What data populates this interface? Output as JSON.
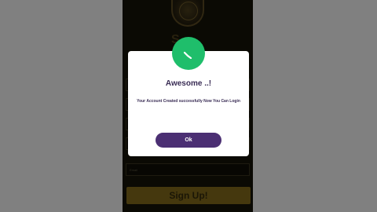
{
  "dialog": {
    "title": "Awesome ..!",
    "message": "Your Account Created successfully Now You Can Login",
    "ok_label": "Ok",
    "icon": "success-check-icon"
  },
  "background": {
    "partial_title": "S",
    "signup_label": "Sign Up!",
    "field_placeholder": "Email"
  },
  "colors": {
    "accent": "#4b2f73",
    "success": "#1fbe6b",
    "text": "#3a2d55",
    "gold": "#c9a433"
  }
}
